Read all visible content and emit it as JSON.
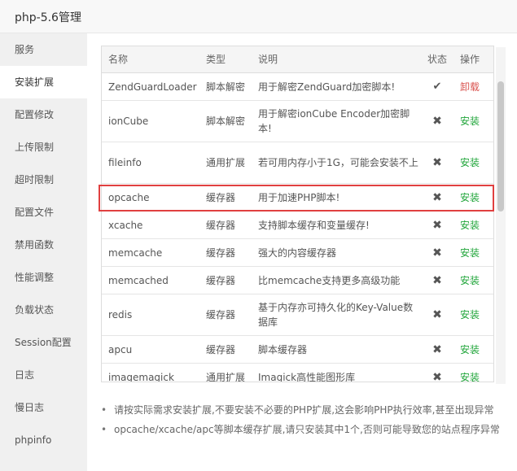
{
  "window": {
    "title": "php-5.6管理"
  },
  "sidebar": {
    "items": [
      {
        "label": "服务"
      },
      {
        "label": "安装扩展"
      },
      {
        "label": "配置修改"
      },
      {
        "label": "上传限制"
      },
      {
        "label": "超时限制"
      },
      {
        "label": "配置文件"
      },
      {
        "label": "禁用函数"
      },
      {
        "label": "性能调整"
      },
      {
        "label": "负载状态"
      },
      {
        "label": "Session配置"
      },
      {
        "label": "日志"
      },
      {
        "label": "慢日志"
      },
      {
        "label": "phpinfo"
      }
    ],
    "active": "安装扩展"
  },
  "table": {
    "headers": {
      "name": "名称",
      "type": "类型",
      "desc": "说明",
      "status": "状态",
      "op": "操作"
    },
    "rows": [
      {
        "name": "ZendGuardLoader",
        "type": "脚本解密",
        "desc": "用于解密ZendGuard加密脚本!",
        "status": "✔",
        "op": "卸载"
      },
      {
        "name": "ionCube",
        "type": "脚本解密",
        "desc": "用于解密ionCube Encoder加密脚本!",
        "status": "✖",
        "op": "安装"
      },
      {
        "name": "fileinfo",
        "type": "通用扩展",
        "desc": "若可用内存小于1G，可能会安装不上",
        "status": "✖",
        "op": "安装"
      },
      {
        "name": "opcache",
        "type": "缓存器",
        "desc": "用于加速PHP脚本!",
        "status": "✖",
        "op": "安装"
      },
      {
        "name": "xcache",
        "type": "缓存器",
        "desc": "支持脚本缓存和变量缓存!",
        "status": "✖",
        "op": "安装"
      },
      {
        "name": "memcache",
        "type": "缓存器",
        "desc": "强大的内容缓存器",
        "status": "✖",
        "op": "安装"
      },
      {
        "name": "memcached",
        "type": "缓存器",
        "desc": "比memcache支持更多高级功能",
        "status": "✖",
        "op": "安装"
      },
      {
        "name": "redis",
        "type": "缓存器",
        "desc": "基于内存亦可持久化的Key-Value数据库",
        "status": "✖",
        "op": "安装"
      },
      {
        "name": "apcu",
        "type": "缓存器",
        "desc": "脚本缓存器",
        "status": "✖",
        "op": "安装"
      },
      {
        "name": "imagemagick",
        "type": "通用扩展",
        "desc": "Imagick高性能图形库",
        "status": "✖",
        "op": "安装"
      }
    ]
  },
  "notes": [
    "请按实际需求安装扩展,不要安装不必要的PHP扩展,这会影响PHP执行效率,甚至出现异常",
    "opcache/xcache/apc等脚本缓存扩展,请只安装其中1个,否则可能导致您的站点程序异常"
  ]
}
